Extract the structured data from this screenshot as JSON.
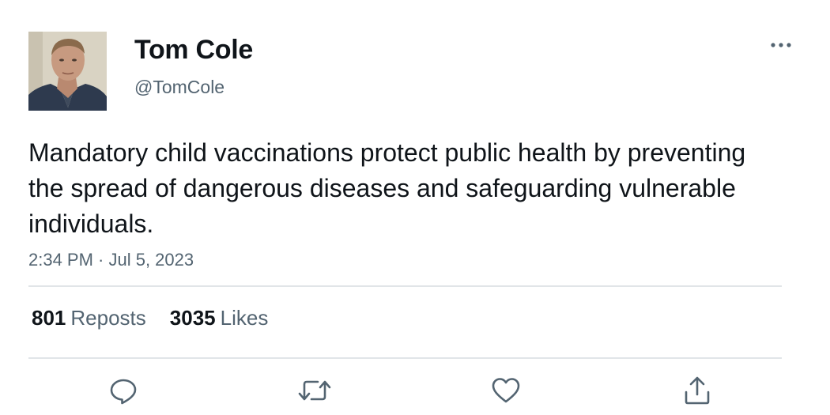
{
  "author": {
    "display_name": "Tom Cole",
    "handle": "@TomCole"
  },
  "tweet": {
    "text": "Mandatory child vaccinations protect public health by preventing the spread of dangerous diseases and safeguarding vulnerable individuals.",
    "timestamp": "2:34 PM · Jul 5, 2023"
  },
  "stats": {
    "reposts_count": "801",
    "reposts_label": "Reposts",
    "likes_count": "3035",
    "likes_label": "Likes"
  },
  "icons": {
    "more": "more-horizontal-icon",
    "reply": "reply-icon",
    "repost": "repost-icon",
    "like": "heart-icon",
    "share": "share-icon"
  },
  "colors": {
    "text_primary": "#0f1419",
    "text_secondary": "#536471",
    "divider": "#e1e5e8"
  }
}
